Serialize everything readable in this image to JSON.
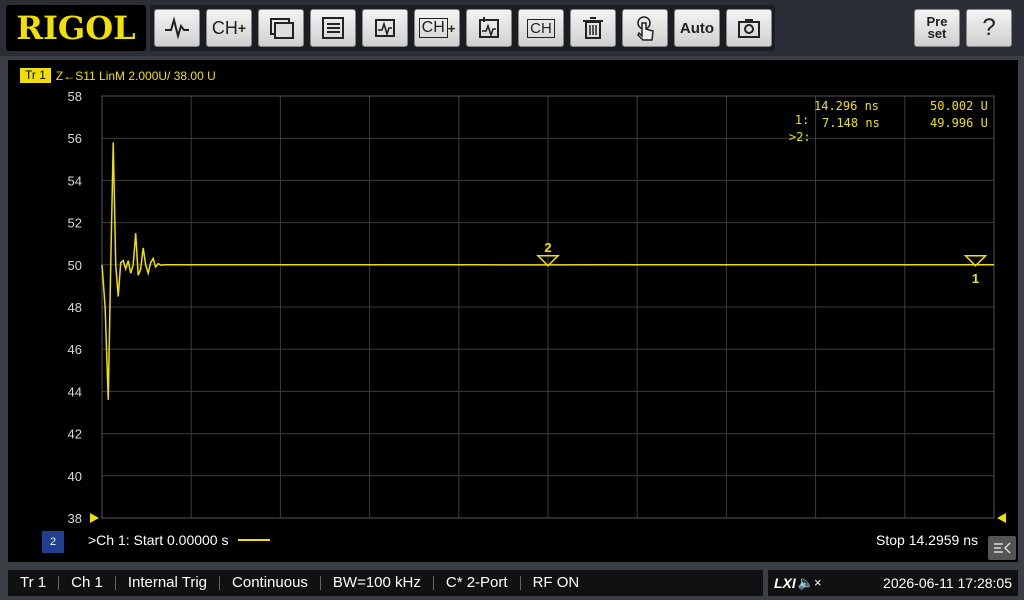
{
  "logo": "RIGOL",
  "toolbar": {
    "buttons": [
      {
        "name": "trace-button",
        "label": ""
      },
      {
        "name": "add-channel-button",
        "label": "CH"
      },
      {
        "name": "window-button",
        "label": ""
      },
      {
        "name": "table-button",
        "label": ""
      },
      {
        "name": "add-trace-button",
        "label": ""
      },
      {
        "name": "add-channel-window-button",
        "label": "CH"
      },
      {
        "name": "edit-trace-button",
        "label": ""
      },
      {
        "name": "edit-channel-button",
        "label": "CH"
      },
      {
        "name": "delete-button",
        "label": ""
      },
      {
        "name": "touch-button",
        "label": ""
      },
      {
        "name": "auto-button",
        "label": "Auto"
      },
      {
        "name": "screenshot-button",
        "label": ""
      }
    ],
    "preset_label": "Pre set",
    "help_label": "?"
  },
  "trace": {
    "badge": "Tr 1",
    "description": "Z←S11 LinM 2.000U/ 38.00 U"
  },
  "markers": {
    "rows": [
      {
        "id": "1:",
        "time": "14.296 ns",
        "value": "50.002 U"
      },
      {
        "id": ">2:",
        "time": "7.148 ns",
        "value": "49.996 U"
      }
    ],
    "marker1_label": "1",
    "marker2_label": "2"
  },
  "chart_data": {
    "type": "line",
    "title": "",
    "xlabel": "",
    "ylabel": "",
    "ylim": [
      38,
      58
    ],
    "xlim": [
      0,
      14.2959
    ],
    "x_unit": "ns",
    "y_ticks": [
      58,
      56,
      54,
      52,
      50,
      48,
      46,
      44,
      42,
      40,
      38
    ],
    "grid": true,
    "series": [
      {
        "color": "#f0e000",
        "x": [
          0,
          0.05,
          0.1,
          0.14,
          0.18,
          0.22,
          0.26,
          0.3,
          0.34,
          0.38,
          0.42,
          0.46,
          0.5,
          0.54,
          0.58,
          0.62,
          0.66,
          0.7,
          0.74,
          0.78,
          0.82,
          0.86,
          0.9,
          0.95,
          1.0,
          1.1,
          1.3,
          2,
          3,
          4,
          5,
          6,
          7.148,
          8,
          9,
          10,
          11,
          12,
          13,
          14.296
        ],
        "values": [
          50,
          48,
          43.6,
          50,
          55.8,
          50,
          48.5,
          50.1,
          50.2,
          49.8,
          50.2,
          49.6,
          50,
          51.5,
          49.5,
          49.8,
          50.8,
          50,
          49.6,
          50.1,
          50.3,
          49.9,
          50.05,
          49.98,
          50,
          50,
          50,
          50,
          50,
          50,
          50,
          50,
          49.996,
          50,
          50,
          50,
          50,
          50,
          50,
          50.002
        ]
      }
    ]
  },
  "footer": {
    "channel_badge": "2",
    "start_label": ">Ch 1:  Start  0.00000 s",
    "stop_label": "Stop  14.2959 ns"
  },
  "status": {
    "items": [
      "Tr 1",
      "Ch 1",
      "Internal Trig",
      "Continuous",
      "BW=100 kHz",
      "C* 2-Port",
      "RF ON"
    ],
    "lxi": "LXI",
    "datetime": "2026-06-11 17:28:05"
  }
}
